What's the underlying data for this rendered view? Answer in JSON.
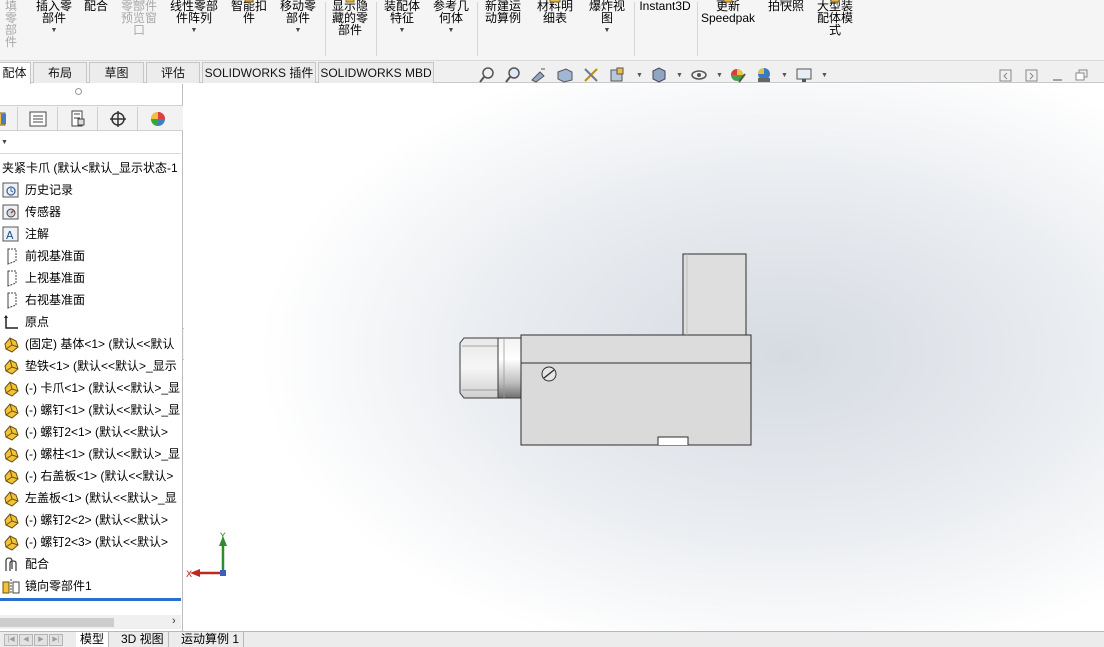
{
  "ribbon": {
    "items": [
      {
        "label": "填零\n部件",
        "dim": true
      },
      {
        "label": "插入零\n部件",
        "arrow": true
      },
      {
        "label": "配合"
      },
      {
        "label": "零部件\n预览窗\n口",
        "dim": true
      },
      {
        "label": "线性零部\n件阵列",
        "arrow": true
      },
      {
        "label": "智能扣\n件"
      },
      {
        "label": "移动零\n部件",
        "arrow": true
      },
      {
        "label": "显示隐\n藏的零\n部件"
      },
      {
        "label": "装配体\n特征",
        "arrow": true
      },
      {
        "label": "参考几\n何体",
        "arrow": true
      },
      {
        "label": "新建运\n动算例"
      },
      {
        "label": "材料明\n细表"
      },
      {
        "label": "爆炸视\n图",
        "arrow": true
      },
      {
        "label": "Instant3D"
      },
      {
        "label": "更新\nSpeedpak"
      },
      {
        "label": "拍快照"
      },
      {
        "label": "大型装\n配体模\n式"
      }
    ],
    "arrow_glyph": "▼"
  },
  "tabs": [
    {
      "label": "配体",
      "active": true
    },
    {
      "label": "布局"
    },
    {
      "label": "草图"
    },
    {
      "label": "评估"
    },
    {
      "label": "SOLIDWORKS 插件"
    },
    {
      "label": "SOLIDWORKS MBD"
    }
  ],
  "heads_up_icons": [
    "zoom-to-fit-icon",
    "zoom-to-area-icon",
    "previous-view-icon",
    "section-view-icon",
    "dynamic-annotation-icon",
    "view-orientation-icon",
    "display-style-icon",
    "hide-show-items-icon",
    "edit-appearance-icon",
    "apply-scene-icon",
    "view-settings-icon"
  ],
  "feature_manager": {
    "panel_tabs": [
      "feature-manager-tab-icon",
      "property-manager-tab-icon",
      "configuration-manager-tab-icon",
      "dimxpert-manager-tab-icon",
      "display-manager-tab-icon"
    ],
    "filter_arrow": "▼",
    "tree": [
      {
        "label": "夹紧卡爪  (默认<默认_显示状态-1",
        "icon": "root"
      },
      {
        "label": "历史记录",
        "icon": "history"
      },
      {
        "label": "传感器",
        "icon": "sensor"
      },
      {
        "label": "注解",
        "icon": "annotation"
      },
      {
        "label": "前视基准面",
        "icon": "plane"
      },
      {
        "label": "上视基准面",
        "icon": "plane"
      },
      {
        "label": "右视基准面",
        "icon": "plane"
      },
      {
        "label": "原点",
        "icon": "origin"
      },
      {
        "label": "(固定) 基体<1> (默认<<默认",
        "icon": "part"
      },
      {
        "label": "垫铁<1> (默认<<默认>_显示",
        "icon": "part"
      },
      {
        "label": "(-) 卡爪<1> (默认<<默认>_显",
        "icon": "part"
      },
      {
        "label": "(-) 螺钉<1> (默认<<默认>_显",
        "icon": "part"
      },
      {
        "label": "(-) 螺钉2<1> (默认<<默认>",
        "icon": "part"
      },
      {
        "label": "(-) 螺柱<1> (默认<<默认>_显",
        "icon": "part"
      },
      {
        "label": "(-) 右盖板<1> (默认<<默认>",
        "icon": "part"
      },
      {
        "label": "左盖板<1> (默认<<默认>_显",
        "icon": "part"
      },
      {
        "label": "(-) 螺钉2<2> (默认<<默认>",
        "icon": "part"
      },
      {
        "label": "(-) 螺钉2<3> (默认<<默认>",
        "icon": "part"
      },
      {
        "label": "配合",
        "icon": "mate"
      },
      {
        "label": "镜向零部件1",
        "icon": "mirror"
      }
    ],
    "scroll_right_glyph": "›"
  },
  "triad": {
    "x_label": "X",
    "y_label": "Y"
  },
  "bottom_tabs": [
    {
      "label": "模型",
      "active": true
    },
    {
      "label": "3D 视图"
    },
    {
      "label": "运动算例 1"
    }
  ],
  "bottom_nav_glyphs": [
    "|◀",
    "◀",
    "▶",
    "▶|"
  ],
  "colors": {
    "accent_blue": "#2a6fd0",
    "part_gray": "#d9d9d9",
    "triad_red": "#c0281f",
    "triad_green": "#2e8b2e"
  }
}
